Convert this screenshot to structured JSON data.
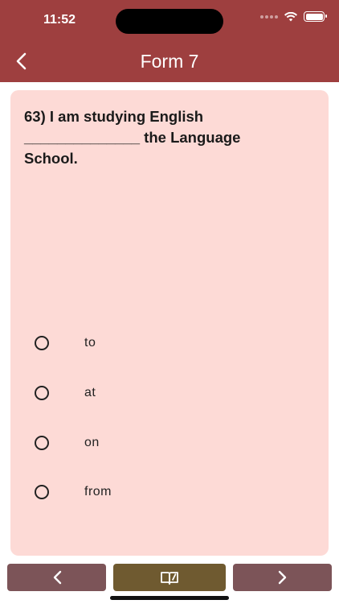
{
  "status_bar": {
    "time": "11:52"
  },
  "header": {
    "title": "Form 7"
  },
  "question": {
    "text_line1": "63) I am studying English",
    "blank": "______________",
    "text_line2_rest": " the Language",
    "text_line3": "School."
  },
  "options": [
    {
      "label": "to"
    },
    {
      "label": "at"
    },
    {
      "label": "on"
    },
    {
      "label": "from"
    }
  ],
  "icons": {
    "back": "chevron-left-icon",
    "prev": "chevron-left-icon",
    "book": "open-book-icon",
    "next": "chevron-right-icon"
  },
  "colors": {
    "header": "#9e3f3f",
    "card": "#fddad6",
    "nav_button": "#7c5458",
    "book_button": "#6f5a30"
  }
}
